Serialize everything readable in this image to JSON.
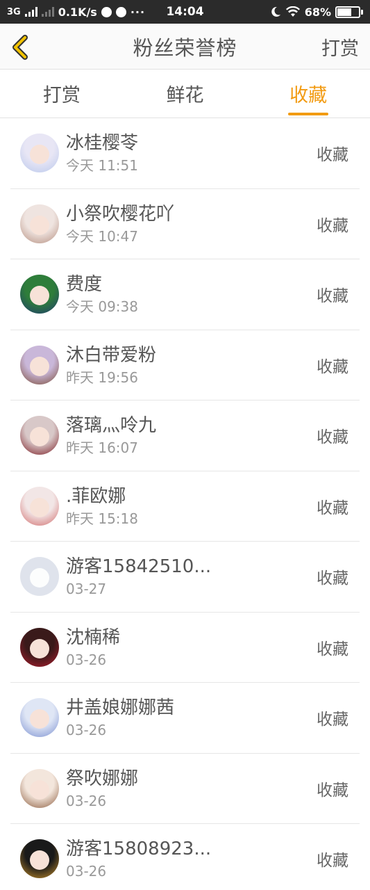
{
  "status_bar": {
    "network": "3G",
    "speed": "0.1K/s",
    "dots": "···",
    "time": "14:04",
    "battery": "68%",
    "battery_level": 0.68
  },
  "header": {
    "title": "粉丝荣誉榜",
    "action_label": "打赏",
    "accent_color": "#f29b12"
  },
  "tabs": [
    {
      "label": "打赏",
      "active": false
    },
    {
      "label": "鲜花",
      "active": false
    },
    {
      "label": "收藏",
      "active": true
    }
  ],
  "fans": [
    {
      "name": "冰桂樱苓",
      "time": "今天 11:51",
      "action": "收藏",
      "avatar_colors": [
        "#e8e6f5",
        "#b9c8ec"
      ]
    },
    {
      "name": "小祭吹樱花吖",
      "time": "今天 10:47",
      "action": "收藏",
      "avatar_colors": [
        "#efe4e0",
        "#b58f80"
      ]
    },
    {
      "name": "费度",
      "time": "今天 09:38",
      "action": "收藏",
      "avatar_colors": [
        "#2e7d3a",
        "#1f3b6e"
      ]
    },
    {
      "name": "沐白带爱粉",
      "time": "昨天 19:56",
      "action": "收藏",
      "avatar_colors": [
        "#c9b7d9",
        "#7a4a35"
      ]
    },
    {
      "name": "落璃灬呤九",
      "time": "昨天 16:07",
      "action": "收藏",
      "avatar_colors": [
        "#d8c8c8",
        "#7a1a22"
      ]
    },
    {
      "name": ".菲欧娜",
      "time": "昨天 15:18",
      "action": "收藏",
      "avatar_colors": [
        "#f2e6e6",
        "#d06a6a"
      ]
    },
    {
      "name": "游客15842510...",
      "time": "03-27",
      "action": "收藏",
      "avatar_colors": [
        "#dfe3ec",
        "#dfe3ec"
      ]
    },
    {
      "name": "沈楠稀",
      "time": "03-26",
      "action": "收藏",
      "avatar_colors": [
        "#3a1a1a",
        "#b01c2e"
      ]
    },
    {
      "name": "井盖娘娜娜茜",
      "time": "03-26",
      "action": "收藏",
      "avatar_colors": [
        "#dfe6f5",
        "#7a8fd0"
      ]
    },
    {
      "name": "祭吹娜娜",
      "time": "03-26",
      "action": "收藏",
      "avatar_colors": [
        "#f3e6dc",
        "#8a5a3c"
      ]
    },
    {
      "name": "游客15808923...",
      "time": "03-26",
      "action": "收藏",
      "avatar_colors": [
        "#1a1a1a",
        "#c8902a"
      ]
    }
  ]
}
